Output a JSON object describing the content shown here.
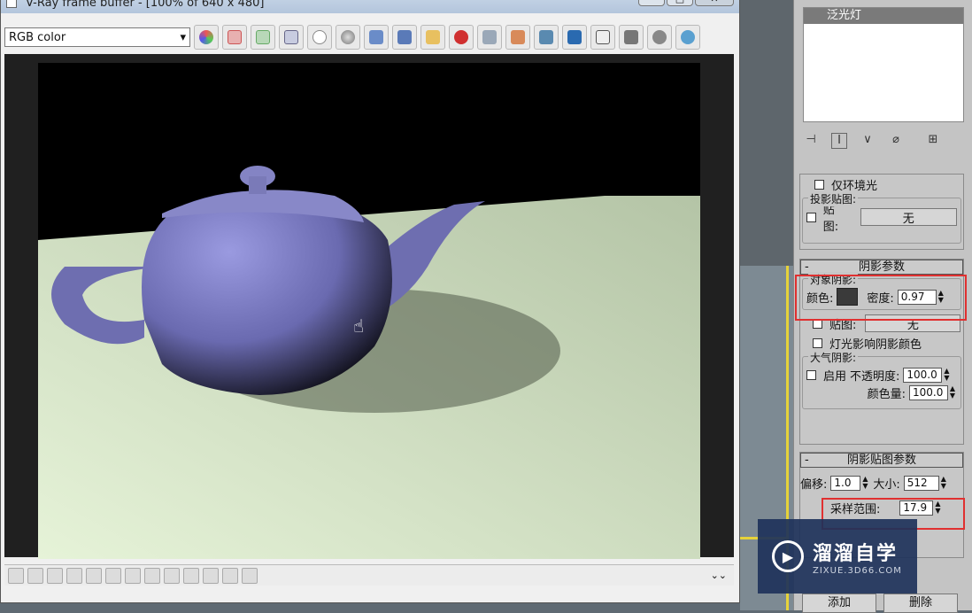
{
  "vfb": {
    "title": "V-Ray frame buffer - [100% of 640 x 480]",
    "channel": "RGB color",
    "toolbar_icons": [
      "color-tracking-icon",
      "red-channel-icon",
      "green-channel-icon",
      "blue-channel-icon",
      "alpha-channel-icon",
      "mono-icon",
      "save-icon",
      "save-all-icon",
      "open-icon",
      "clear-icon",
      "duplicate-icon",
      "region-icon",
      "track-mouse-icon",
      "history-icon",
      "compare-icon",
      "settings-icon",
      "stop-icon",
      "render-icon"
    ]
  },
  "panel": {
    "light_list": [
      "泛光灯"
    ],
    "ambient_only_label": "仅环境光",
    "projector_map_title": "投影贴图:",
    "map_label": "贴图:",
    "map_none": "无",
    "shadow_params_title": "阴影参数",
    "object_shadows_title": "对象阴影:",
    "color_label": "颜色:",
    "density_label": "密度:",
    "density_value": "0.97",
    "shadow_map_label": "贴图:",
    "shadow_map_none": "无",
    "light_affects_label": "灯光影响阴影颜色",
    "atmos_title": "大气阴影:",
    "enable_label": "启用",
    "opacity_label": "不透明度:",
    "opacity_value": "100.0",
    "color_amount_label": "颜色量:",
    "color_amount_value": "100.0",
    "shadow_map_params_title": "阴影贴图参数",
    "bias_label": "偏移:",
    "bias_value": "1.0",
    "size_label": "大小:",
    "size_value": "512",
    "sample_range_label": "采样范围:",
    "sample_range_value": "17.9",
    "add_button": "添加",
    "delete_button": "删除"
  },
  "watermark": {
    "brand": "溜溜自学",
    "url": "ZIXUE.3D66.COM"
  },
  "colors": {
    "floor": "#c8d8b8",
    "teapot": "#7a7ab8",
    "highlight": "#e03030"
  }
}
